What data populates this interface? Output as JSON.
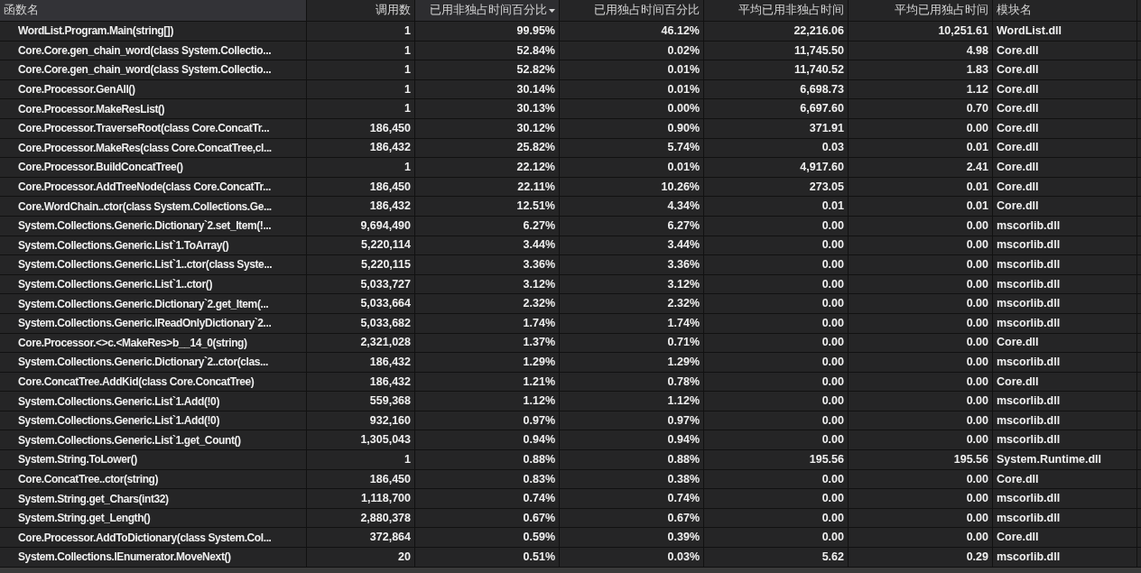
{
  "table": {
    "columns": [
      {
        "label": "函数名",
        "sorted": false
      },
      {
        "label": "调用数",
        "sorted": false
      },
      {
        "label": "已用非独占时间百分比",
        "sorted": true
      },
      {
        "label": "已用独占时间百分比",
        "sorted": false
      },
      {
        "label": "平均已用非独占时间",
        "sorted": false
      },
      {
        "label": "平均已用独占时间",
        "sorted": false
      },
      {
        "label": "模块名",
        "sorted": false
      }
    ],
    "rows": [
      [
        "WordList.Program.Main(string[])",
        "1",
        "99.95%",
        "46.12%",
        "22,216.06",
        "10,251.61",
        "WordList.dll"
      ],
      [
        "Core.Core.gen_chain_word(class System.Collectio...",
        "1",
        "52.84%",
        "0.02%",
        "11,745.50",
        "4.98",
        "Core.dll"
      ],
      [
        "Core.Core.gen_chain_word(class System.Collectio...",
        "1",
        "52.82%",
        "0.01%",
        "11,740.52",
        "1.83",
        "Core.dll"
      ],
      [
        "Core.Processor.GenAll()",
        "1",
        "30.14%",
        "0.01%",
        "6,698.73",
        "1.12",
        "Core.dll"
      ],
      [
        "Core.Processor.MakeResList()",
        "1",
        "30.13%",
        "0.00%",
        "6,697.60",
        "0.70",
        "Core.dll"
      ],
      [
        "Core.Processor.TraverseRoot(class Core.ConcatTr...",
        "186,450",
        "30.12%",
        "0.90%",
        "371.91",
        "0.00",
        "Core.dll"
      ],
      [
        "Core.Processor.MakeRes(class Core.ConcatTree,cl...",
        "186,432",
        "25.82%",
        "5.74%",
        "0.03",
        "0.01",
        "Core.dll"
      ],
      [
        "Core.Processor.BuildConcatTree()",
        "1",
        "22.12%",
        "0.01%",
        "4,917.60",
        "2.41",
        "Core.dll"
      ],
      [
        "Core.Processor.AddTreeNode(class Core.ConcatTr...",
        "186,450",
        "22.11%",
        "10.26%",
        "273.05",
        "0.01",
        "Core.dll"
      ],
      [
        "Core.WordChain..ctor(class System.Collections.Ge...",
        "186,432",
        "12.51%",
        "4.34%",
        "0.01",
        "0.01",
        "Core.dll"
      ],
      [
        "System.Collections.Generic.Dictionary`2.set_Item(!...",
        "9,694,490",
        "6.27%",
        "6.27%",
        "0.00",
        "0.00",
        "mscorlib.dll"
      ],
      [
        "System.Collections.Generic.List`1.ToArray()",
        "5,220,114",
        "3.44%",
        "3.44%",
        "0.00",
        "0.00",
        "mscorlib.dll"
      ],
      [
        "System.Collections.Generic.List`1..ctor(class Syste...",
        "5,220,115",
        "3.36%",
        "3.36%",
        "0.00",
        "0.00",
        "mscorlib.dll"
      ],
      [
        "System.Collections.Generic.List`1..ctor()",
        "5,033,727",
        "3.12%",
        "3.12%",
        "0.00",
        "0.00",
        "mscorlib.dll"
      ],
      [
        "System.Collections.Generic.Dictionary`2.get_Item(...",
        "5,033,664",
        "2.32%",
        "2.32%",
        "0.00",
        "0.00",
        "mscorlib.dll"
      ],
      [
        "System.Collections.Generic.IReadOnlyDictionary`2...",
        "5,033,682",
        "1.74%",
        "1.74%",
        "0.00",
        "0.00",
        "mscorlib.dll"
      ],
      [
        "Core.Processor.<>c.<MakeRes>b__14_0(string)",
        "2,321,028",
        "1.37%",
        "0.71%",
        "0.00",
        "0.00",
        "Core.dll"
      ],
      [
        "System.Collections.Generic.Dictionary`2..ctor(clas...",
        "186,432",
        "1.29%",
        "1.29%",
        "0.00",
        "0.00",
        "mscorlib.dll"
      ],
      [
        "Core.ConcatTree.AddKid(class Core.ConcatTree)",
        "186,432",
        "1.21%",
        "0.78%",
        "0.00",
        "0.00",
        "Core.dll"
      ],
      [
        "System.Collections.Generic.List`1.Add(!0)",
        "559,368",
        "1.12%",
        "1.12%",
        "0.00",
        "0.00",
        "mscorlib.dll"
      ],
      [
        "System.Collections.Generic.List`1.Add(!0)",
        "932,160",
        "0.97%",
        "0.97%",
        "0.00",
        "0.00",
        "mscorlib.dll"
      ],
      [
        "System.Collections.Generic.List`1.get_Count()",
        "1,305,043",
        "0.94%",
        "0.94%",
        "0.00",
        "0.00",
        "mscorlib.dll"
      ],
      [
        "System.String.ToLower()",
        "1",
        "0.88%",
        "0.88%",
        "195.56",
        "195.56",
        "System.Runtime.dll"
      ],
      [
        "Core.ConcatTree..ctor(string)",
        "186,450",
        "0.83%",
        "0.38%",
        "0.00",
        "0.00",
        "Core.dll"
      ],
      [
        "System.String.get_Chars(int32)",
        "1,118,700",
        "0.74%",
        "0.74%",
        "0.00",
        "0.00",
        "mscorlib.dll"
      ],
      [
        "System.String.get_Length()",
        "2,880,378",
        "0.67%",
        "0.67%",
        "0.00",
        "0.00",
        "mscorlib.dll"
      ],
      [
        "Core.Processor.AddToDictionary(class System.Col...",
        "372,864",
        "0.59%",
        "0.39%",
        "0.00",
        "0.00",
        "Core.dll"
      ],
      [
        "System.Collections.IEnumerator.MoveNext()",
        "20",
        "0.51%",
        "0.03%",
        "5.62",
        "0.29",
        "mscorlib.dll"
      ]
    ]
  }
}
